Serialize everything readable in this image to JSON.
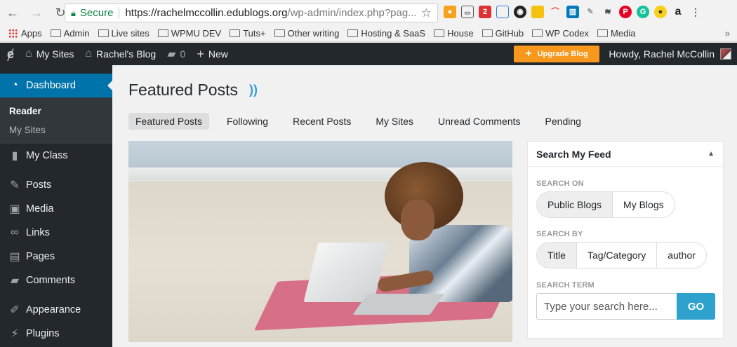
{
  "browser": {
    "secure_label": "Secure",
    "url_main": "https://rachelmccollin.edublogs.org",
    "url_rest": "/wp-admin/index.php?pag...",
    "bookmarks": [
      "Apps",
      "Admin",
      "Live sites",
      "WPMU DEV",
      "Tuts+",
      "Other writing",
      "Hosting & SaaS",
      "House",
      "GitHub",
      "WP Codex",
      "Media"
    ],
    "ext_badge": "2"
  },
  "adminbar": {
    "my_sites": "My Sites",
    "blog_name": "Rachel's Blog",
    "comments_count": "0",
    "new_label": "New",
    "upgrade_label": "Upgrade Blog",
    "howdy": "Howdy, Rachel McCollin"
  },
  "sidebar": {
    "dashboard": "Dashboard",
    "submenu": [
      "Reader",
      "My Sites"
    ],
    "items": [
      "My Class",
      "Posts",
      "Media",
      "Links",
      "Pages",
      "Comments",
      "Appearance",
      "Plugins"
    ]
  },
  "main": {
    "title": "Featured Posts",
    "tabs": [
      "Featured Posts",
      "Following",
      "Recent Posts",
      "My Sites",
      "Unread Comments",
      "Pending"
    ]
  },
  "widget": {
    "title": "Search My Feed",
    "search_on_label": "SEARCH ON",
    "search_on": [
      "Public Blogs",
      "My Blogs"
    ],
    "search_by_label": "SEARCH BY",
    "search_by": [
      "Title",
      "Tag/Category",
      "author"
    ],
    "search_term_label": "SEARCH TERM",
    "placeholder": "Type your search here...",
    "go_label": "GO"
  }
}
